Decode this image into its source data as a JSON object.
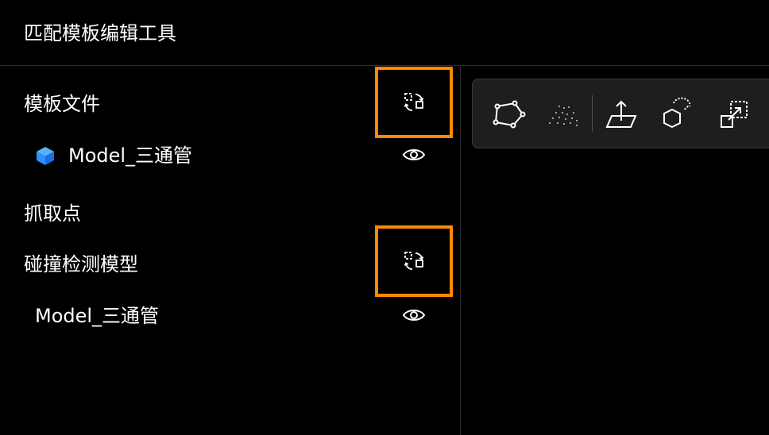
{
  "app": {
    "title": "匹配模板编辑工具"
  },
  "sections": {
    "template_file": {
      "title": "模板文件",
      "item_label": "Model_三通管"
    },
    "grab_point": {
      "title": "抓取点"
    },
    "collision_model": {
      "title": "碰撞检测模型",
      "item_label": "Model_三通管"
    }
  },
  "icons": {
    "refresh": "refresh-swap-icon",
    "visibility": "eye-icon",
    "model": "cube-icon",
    "tools": [
      "polygon-icon",
      "point-cloud-icon",
      "plane-icon",
      "hexagon-cloud-icon",
      "resize-icon"
    ]
  },
  "colors": {
    "highlight": "#ff8a00",
    "cube": "#2f8fff",
    "background": "#000000",
    "toolbar": "#1e1e1e"
  }
}
